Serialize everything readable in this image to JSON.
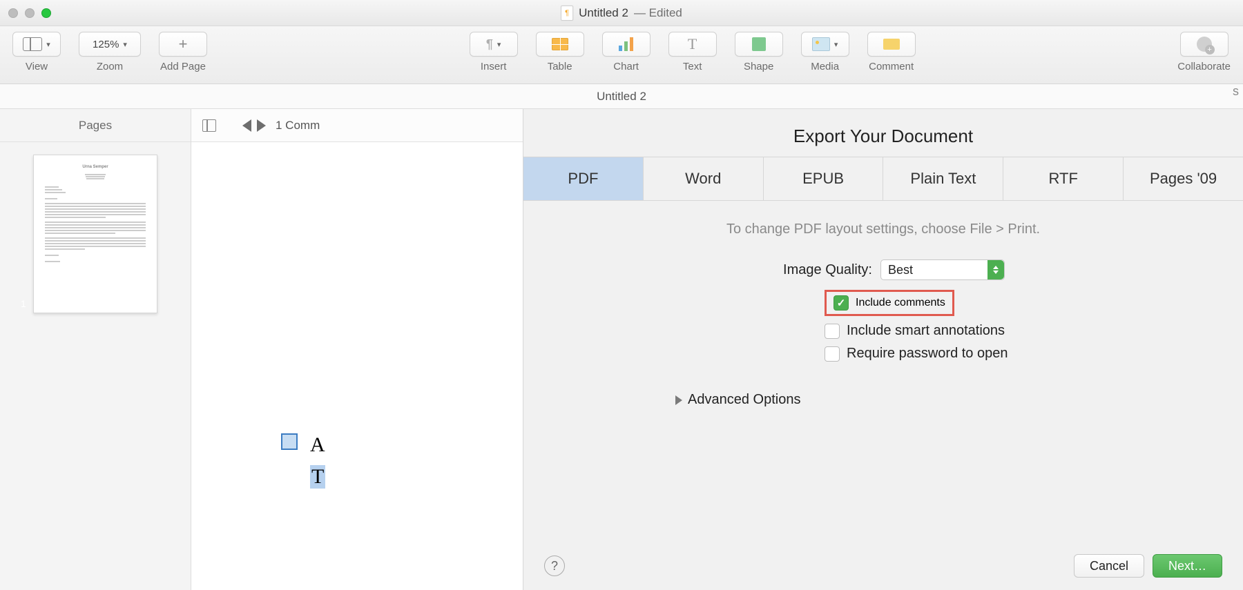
{
  "window": {
    "title": "Untitled 2",
    "edited": "— Edited"
  },
  "toolbar": {
    "view": "View",
    "zoom_label": "Zoom",
    "zoom_value": "125%",
    "add_page": "Add Page",
    "insert": "Insert",
    "table": "Table",
    "chart": "Chart",
    "text": "Text",
    "shape": "Shape",
    "media": "Media",
    "comment": "Comment",
    "collaborate": "Collaborate"
  },
  "docbar": {
    "title": "Untitled 2"
  },
  "sidebar": {
    "title": "Pages",
    "page_number": "1",
    "thumb_heading": "Urna Semper"
  },
  "comments": {
    "count_label": "1 Comm"
  },
  "canvas": {
    "letter_a": "A",
    "highlighted": "T"
  },
  "dialog": {
    "title": "Export Your Document",
    "tabs": [
      "PDF",
      "Word",
      "EPUB",
      "Plain Text",
      "RTF",
      "Pages '09"
    ],
    "hint": "To change PDF layout settings, choose File > Print.",
    "image_quality_label": "Image Quality:",
    "image_quality_value": "Best",
    "include_comments": "Include comments",
    "include_annotations": "Include smart annotations",
    "require_password": "Require password to open",
    "advanced": "Advanced Options",
    "cancel": "Cancel",
    "next": "Next…",
    "right_initial": "s"
  }
}
